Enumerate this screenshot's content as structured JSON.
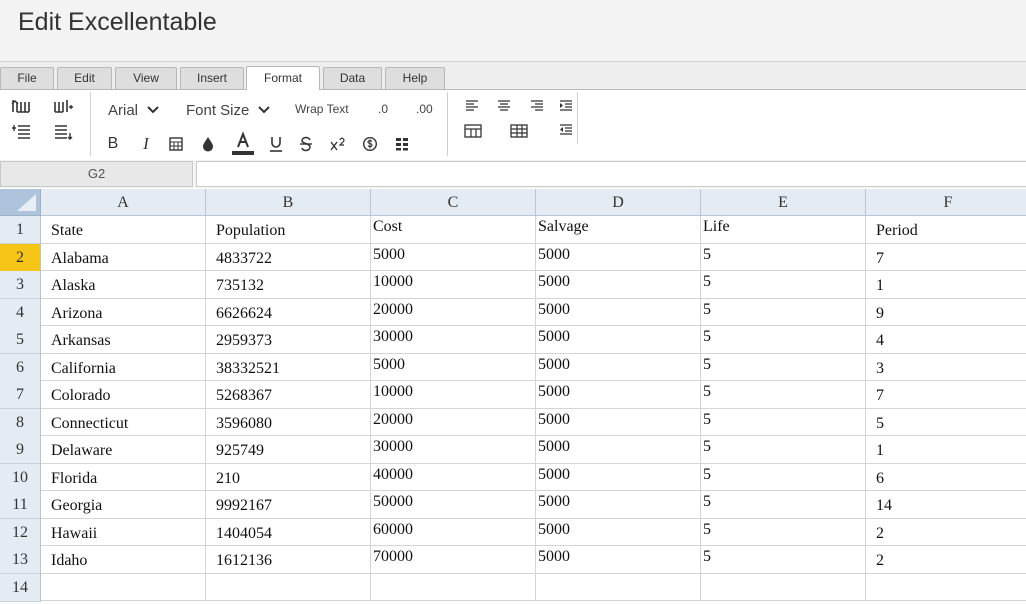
{
  "app": {
    "title": "Edit Excellentable"
  },
  "tabs": [
    "File",
    "Edit",
    "View",
    "Insert",
    "Format",
    "Data",
    "Help"
  ],
  "toolbar": {
    "font": "Arial",
    "font_size": "Font Size",
    "wrap_text": "Wrap Text",
    "dec_decrease": ".0",
    "dec_increase": ".00",
    "bold": "B",
    "italic": "I"
  },
  "formula_bar": {
    "cell_ref": "G2",
    "value": ""
  },
  "sheet": {
    "columns": [
      "A",
      "B",
      "C",
      "D",
      "E",
      "F"
    ],
    "selected_row": 2,
    "rows": [
      {
        "num": "1",
        "cells": [
          "State",
          "Population",
          "Cost",
          "Salvage",
          "Life",
          "Period"
        ]
      },
      {
        "num": "2",
        "cells": [
          "Alabama",
          "4833722",
          "5000",
          "5000",
          "5",
          "7"
        ]
      },
      {
        "num": "3",
        "cells": [
          "Alaska",
          "735132",
          "10000",
          "5000",
          "5",
          "1"
        ]
      },
      {
        "num": "4",
        "cells": [
          "Arizona",
          "6626624",
          "20000",
          "5000",
          "5",
          "9"
        ]
      },
      {
        "num": "5",
        "cells": [
          "Arkansas",
          "2959373",
          "30000",
          "5000",
          "5",
          "4"
        ]
      },
      {
        "num": "6",
        "cells": [
          "California",
          "38332521",
          "5000",
          "5000",
          "5",
          "3"
        ]
      },
      {
        "num": "7",
        "cells": [
          "Colorado",
          "5268367",
          "10000",
          "5000",
          "5",
          "7"
        ]
      },
      {
        "num": "8",
        "cells": [
          "Connecticut",
          "3596080",
          "20000",
          "5000",
          "5",
          "5"
        ]
      },
      {
        "num": "9",
        "cells": [
          "Delaware",
          "925749",
          "30000",
          "5000",
          "5",
          "1"
        ]
      },
      {
        "num": "10",
        "cells": [
          "Florida",
          "210",
          "40000",
          "5000",
          "5",
          "6"
        ]
      },
      {
        "num": "11",
        "cells": [
          "Georgia",
          "9992167",
          "50000",
          "5000",
          "5",
          "14"
        ]
      },
      {
        "num": "12",
        "cells": [
          "Hawaii",
          "1404054",
          "60000",
          "5000",
          "5",
          "2"
        ]
      },
      {
        "num": "13",
        "cells": [
          "Idaho",
          "1612136",
          "70000",
          "5000",
          "5",
          "2"
        ]
      },
      {
        "num": "14",
        "cells": [
          "",
          "",
          "",
          "",
          "",
          ""
        ]
      }
    ]
  }
}
